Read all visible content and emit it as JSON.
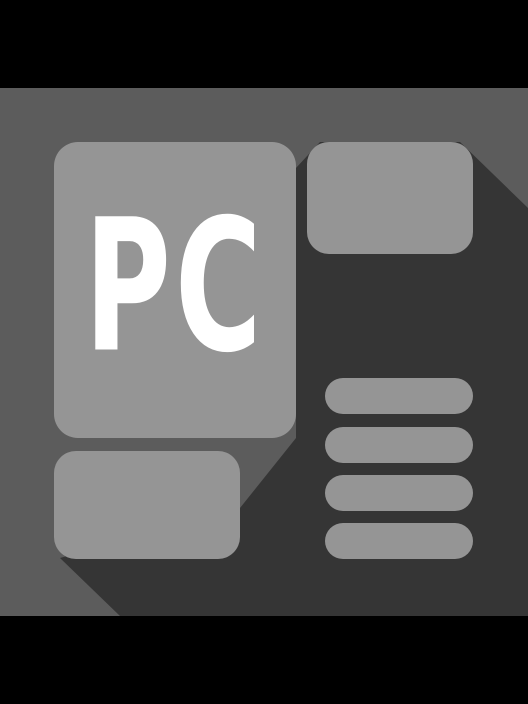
{
  "icon": {
    "label": "PC"
  },
  "colors": {
    "background": "#000000",
    "icon_background": "#5c5c5c",
    "long_shadow": "#353535",
    "tile": "#959595",
    "label_text": "#ffffff"
  }
}
